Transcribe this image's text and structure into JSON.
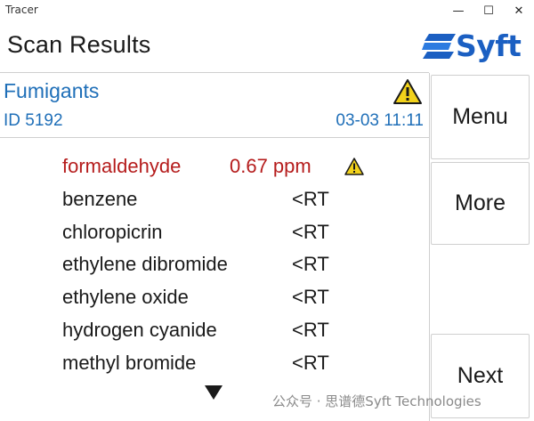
{
  "window": {
    "app_title": "Tracer",
    "minimize": "—",
    "maximize": "☐",
    "close": "✕"
  },
  "header": {
    "title": "Scan Results",
    "logo_text": "Syft"
  },
  "info": {
    "group": "Fumigants",
    "id": "ID 5192",
    "timestamp": "03-03 11:11"
  },
  "results": [
    {
      "chemical": "formaldehyde",
      "value": "0.67 ppm",
      "alarm": true
    },
    {
      "chemical": "benzene",
      "value": "<RT",
      "alarm": false
    },
    {
      "chemical": "chloropicrin",
      "value": "<RT",
      "alarm": false
    },
    {
      "chemical": "ethylene dibromide",
      "value": "<RT",
      "alarm": false
    },
    {
      "chemical": "ethylene oxide",
      "value": "<RT",
      "alarm": false
    },
    {
      "chemical": "hydrogen cyanide",
      "value": "<RT",
      "alarm": false
    },
    {
      "chemical": "methyl bromide",
      "value": "<RT",
      "alarm": false
    }
  ],
  "buttons": {
    "menu": "Menu",
    "more": "More",
    "next": "Next"
  },
  "watermark": "公众号 · 思谱德Syft Technologies",
  "colors": {
    "accent": "#1f6fb8",
    "alarm": "#b51c1c",
    "warning": "#f2d21b",
    "brand": "#1b5fc2"
  },
  "icons": {
    "warning": "warning-triangle-icon",
    "scroll": "scroll-down-icon"
  }
}
